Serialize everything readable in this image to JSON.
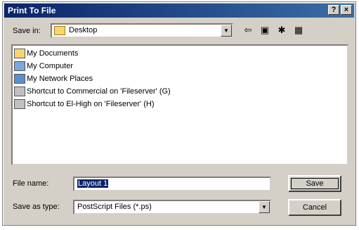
{
  "window": {
    "title": "Print To File",
    "help_button": "?",
    "close_button": "×"
  },
  "save_in": {
    "label": "Save in:",
    "value": "Desktop"
  },
  "toolbar": {
    "back_icon": "back-arrow-icon",
    "up_folder_icon": "up-one-level-icon",
    "new_folder_icon": "new-folder-icon",
    "view_menu_icon": "view-menu-icon"
  },
  "files": [
    {
      "label": "My Documents",
      "icon": "my-documents-icon"
    },
    {
      "label": "My Computer",
      "icon": "my-computer-icon"
    },
    {
      "label": "My Network Places",
      "icon": "network-places-icon"
    },
    {
      "label": "Shortcut to Commercial on 'Fileserver' (G)",
      "icon": "network-drive-icon"
    },
    {
      "label": "Shortcut to El-High on 'Fileserver' (H)",
      "icon": "network-drive-icon"
    }
  ],
  "file_name": {
    "label": "File name:",
    "value": "Layout 1"
  },
  "save_as_type": {
    "label": "Save as type:",
    "value": "PostScript Files (*.ps)"
  },
  "buttons": {
    "save": "Save",
    "cancel": "Cancel"
  }
}
